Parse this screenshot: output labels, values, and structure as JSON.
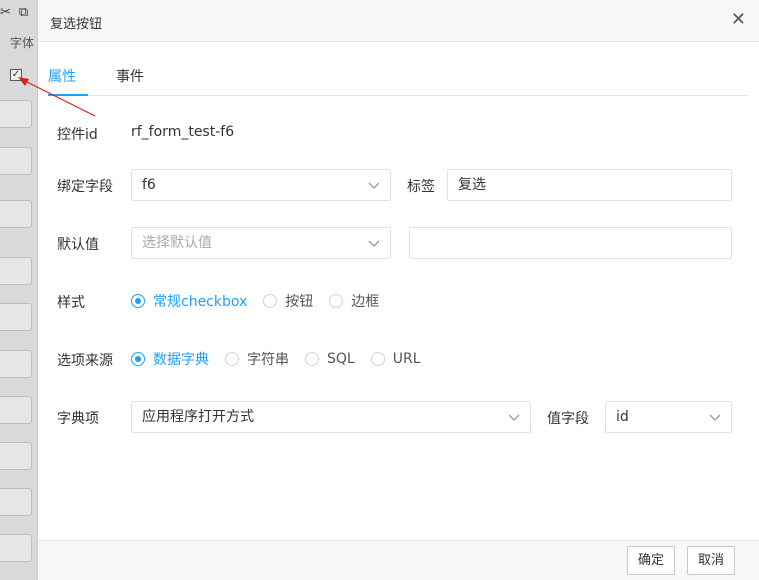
{
  "background": {
    "font_label": "字体"
  },
  "dialog": {
    "title": "复选按钮",
    "close_glyph": "✕"
  },
  "tabs": [
    {
      "label": "属性"
    },
    {
      "label": "事件"
    }
  ],
  "form": {
    "control_id": {
      "label": "控件id",
      "value": "rf_form_test-f6"
    },
    "bind_field": {
      "label": "绑定字段",
      "value": "f6"
    },
    "tag": {
      "label": "标签",
      "value": "复选"
    },
    "default_value": {
      "label": "默认值",
      "placeholder": "选择默认值",
      "extra_value": ""
    },
    "style": {
      "label": "样式",
      "options": [
        {
          "label": "常规checkbox",
          "checked": true
        },
        {
          "label": "按钮",
          "checked": false
        },
        {
          "label": "边框",
          "checked": false
        }
      ]
    },
    "option_source": {
      "label": "选项来源",
      "options": [
        {
          "label": "数据字典",
          "checked": true
        },
        {
          "label": "字符串",
          "checked": false
        },
        {
          "label": "SQL",
          "checked": false
        },
        {
          "label": "URL",
          "checked": false
        }
      ]
    },
    "dict_item": {
      "label": "字典项",
      "value": "应用程序打开方式"
    },
    "value_field": {
      "label": "值字段",
      "value": "id"
    }
  },
  "footer": {
    "confirm_label": "确定",
    "cancel_label": "取消"
  },
  "colors": {
    "accent": "#1E9FFF",
    "annotation_arrow": "#e02020"
  }
}
